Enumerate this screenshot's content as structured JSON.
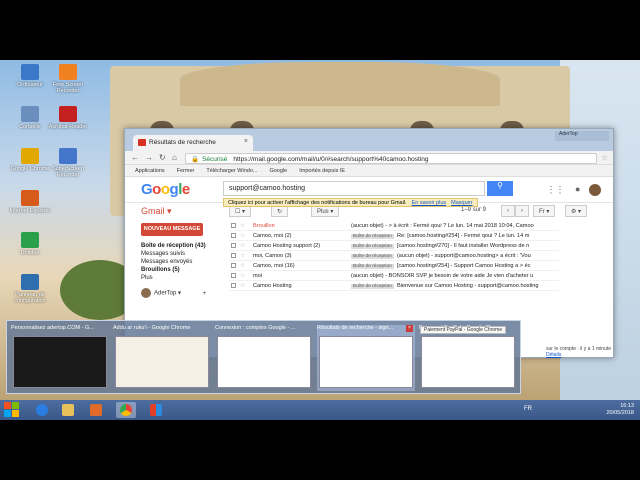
{
  "desktop_icons": [
    {
      "label": "Ordinateur",
      "color": "#3c78c8"
    },
    {
      "label": "Corbeille",
      "color": "#6a8fbf"
    },
    {
      "label": "Google Chrome",
      "color": "#e0a800"
    },
    {
      "label": "Internet Explorer",
      "color": "#d65a1a"
    },
    {
      "label": "Uniblue",
      "color": "#2aa04a"
    },
    {
      "label": "Panneau de configuration",
      "color": "#2f6fb0"
    },
    {
      "label": "Free Screen Recorder",
      "color": "#f08020"
    },
    {
      "label": "Acrobat Reader",
      "color": "#c42020"
    },
    {
      "label": "SuperScreen Recorder",
      "color": "#4477cc"
    }
  ],
  "chrome": {
    "tab_title": "Résultats de recherche",
    "window_user": "AderTop",
    "secure_label": "Sécurisé",
    "url": "https://mail.google.com/mail/u/0/#search/support%40camoo.hosting",
    "bookmarks": [
      "Applications",
      "Fermer",
      "Télécharger Windo...",
      "Google",
      "Importés depuis IE"
    ]
  },
  "gmail": {
    "search_value": "support@camoo.hosting",
    "notification": "Cliquez ici pour activer l'affichage des notifications de bureau pour Gmail.",
    "notif_link1": "En savoir plus",
    "notif_link2": "Masquer",
    "gmail_label": "Gmail",
    "more_btn": "Plus",
    "pager": "1–9 sur 9",
    "lang_btn": "Fr",
    "compose_label": "NOUVEAU MESSAGE",
    "sidebar": [
      {
        "label": "Boîte de réception (43)",
        "bold": true
      },
      {
        "label": "Messages suivis",
        "bold": false
      },
      {
        "label": "Messages envoyés",
        "bold": false
      },
      {
        "label": "Brouillons (5)",
        "bold": true
      },
      {
        "label": "Plus",
        "bold": false
      }
    ],
    "user_name": "AderTop",
    "rows": [
      {
        "from": "Brouillon",
        "label": "",
        "subject": "(aucun objet) - > à écrit : Fermé qoui ? Le lun. 14 mai 2018 10:04, Camoo",
        "date": "14 mai",
        "draft": true
      },
      {
        "from": "Camoo, moi (2)",
        "label": "Boîte de réception",
        "subject": "Re: [camoo.hosting#254] - Fermé qoui ? Le lun. 14 m",
        "date": "14 mai",
        "draft": false
      },
      {
        "from": "Camoo Hosting support (2)",
        "label": "Boîte de réception",
        "subject": "[camoo.hosting#270] - Il faut installer Wordpress de n",
        "date": "9 mai",
        "draft": false
      },
      {
        "from": "moi, Camoo (3)",
        "label": "Boîte de réception",
        "subject": "(aucun objet) - support@camoo.hosting> a écrit : 'Vou",
        "date": "1 mai",
        "draft": false
      },
      {
        "from": "Camoo, moi (16)",
        "label": "Boîte de réception",
        "subject": "[camoo.hosting#254] - Support Camoo Hosting a > éc",
        "date": "1 mai",
        "draft": false
      },
      {
        "from": "moi",
        "label": "",
        "subject": "(aucun objet) - BONSOIR SVP je besoin de votre aide Je vien d'acheter u",
        "date": "28 avr.",
        "draft": false
      },
      {
        "from": "Camoo Hosting",
        "label": "Boîte de réception",
        "subject": "Bienvenue sur Camoo Hosting - support@camoo.hosting",
        "date": "26 janv.",
        "draft": false
      }
    ],
    "hint_text": "sur le compte : il y a 1 minute",
    "hint_link": "Détails"
  },
  "switcher": [
    {
      "title": "Personnalisez adertop.COM - G...",
      "preview": "dark",
      "selected": false,
      "closable": false
    },
    {
      "title": "Addu ar ruku'i - Google Chrome",
      "preview": "light",
      "selected": false,
      "closable": false
    },
    {
      "title": "Connexion : comptes Google - ...",
      "preview": "white",
      "selected": false,
      "closable": false
    },
    {
      "title": "Résultats de recherche - sign...",
      "preview": "white",
      "selected": true,
      "closable": true
    },
    {
      "title": "Paiement PayPal - Google Chro...",
      "preview": "white",
      "selected": false,
      "closable": false
    }
  ],
  "switcher_close": "×",
  "tooltip": "Paiement PayPal - Google Chrome",
  "taskbar": {
    "lang": "FR",
    "time": "16:13",
    "date": "20/05/2018"
  }
}
